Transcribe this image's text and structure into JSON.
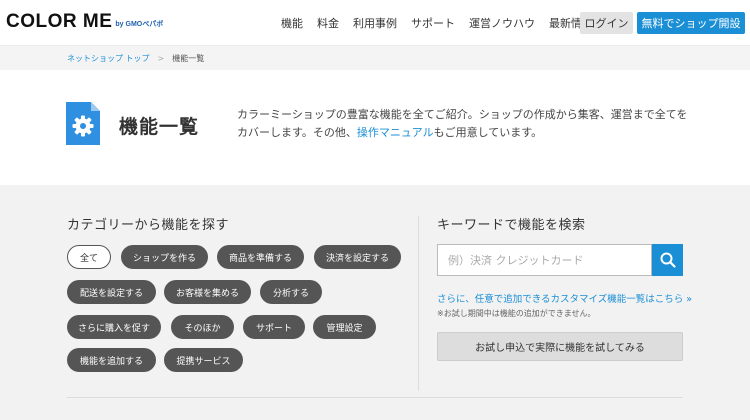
{
  "header": {
    "logo_main": "COLOR ME",
    "logo_sub": "by GMOペパボ",
    "nav": [
      "機能",
      "料金",
      "利用事例",
      "サポート",
      "運営ノウハウ",
      "最新情報"
    ],
    "login_label": "ログイン",
    "signup_label": "無料でショップ開設"
  },
  "breadcrumb": {
    "home": "ネットショップ トップ",
    "separator": ">",
    "current": "機能一覧"
  },
  "hero": {
    "title": "機能一覧",
    "desc_before": "カラーミーショップの豊富な機能を全てご紹介。ショップの作成から集客、運営まで全てをカバーします。その他、",
    "desc_link": "操作マニュアル",
    "desc_after": "もご用意しています。"
  },
  "category": {
    "title": "カテゴリーから機能を探す",
    "chips": [
      "全て",
      "ショップを作る",
      "商品を準備する",
      "決済を設定する",
      "配送を設定する",
      "お客様を集める",
      "分析する",
      "さらに購入を促す",
      "そのほか",
      "サポート",
      "管理設定",
      "機能を追加する",
      "提携サービス"
    ]
  },
  "keyword": {
    "title": "キーワードで機能を検索",
    "placeholder": "例）決済 クレジットカード",
    "custom_link": "さらに、任意で追加できるカスタマイズ機能一覧はこちら »",
    "note": "※お試し期間中は機能の追加ができません。",
    "trial_button": "お試し申込で実際に機能を試してみる"
  },
  "colors": {
    "accent": "#1b8fd6",
    "chip_bg": "#555555"
  }
}
